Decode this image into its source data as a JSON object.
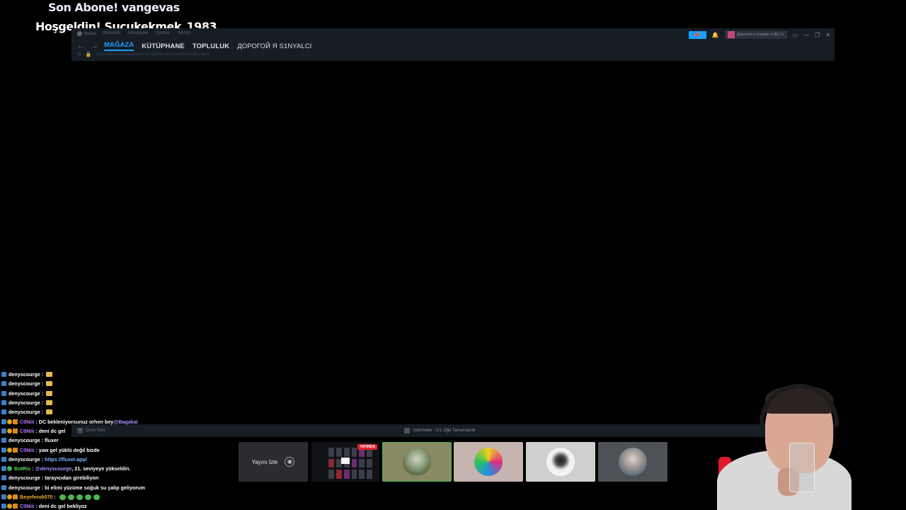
{
  "alerts": {
    "subscriber": "Son Abone! vangevas",
    "follower": "Hoşgeldin! Sucukekmek_1983"
  },
  "steam": {
    "menu": [
      "Steam",
      "Görünüm",
      "Arkadaşlar",
      "Oyunlar",
      "Yardım"
    ],
    "tabs": {
      "store": "MAĞAZA",
      "library": "KÜTÜPHANE",
      "community": "TOPLULUK",
      "profile": "ДОРОГОЙ Я S1NYALCI"
    },
    "url": "https://store.steampowered.com/point/cshop/cprofilebundle/odact/",
    "account": "Дорогой я s1nyalcı ▾ $0.71",
    "add_game": "Oyun Ekle",
    "downloads": "İndirmeler - 1/1 Öğe Tamamlandı",
    "colors": {
      "accent": "#1a9fff",
      "bg": "#171d25"
    }
  },
  "stream_tiles": {
    "watch_label": "Yayını İzle",
    "live_badge": "YAYINDA"
  },
  "chat": [
    {
      "user": "denyscourge",
      "text": "",
      "emote": true,
      "color": "#ffffff",
      "badges": [
        "pl"
      ]
    },
    {
      "user": "denyscourge",
      "text": "",
      "emote": true,
      "color": "#ffffff",
      "badges": [
        "pl"
      ]
    },
    {
      "user": "denyscourge",
      "text": "",
      "emote": true,
      "color": "#ffffff",
      "badges": [
        "pl"
      ]
    },
    {
      "user": "denyscourge",
      "text": "",
      "emote": true,
      "color": "#ffffff",
      "badges": [
        "pl"
      ]
    },
    {
      "user": "denyscourge",
      "text": "",
      "emote": true,
      "color": "#ffffff",
      "badges": [
        "pl"
      ]
    },
    {
      "user": "C0Niii",
      "text": "DC bekleniyorsunuz orhen bey ",
      "mention": "@Bagakai",
      "color": "#b57cff",
      "badges": [
        "pl",
        "mod",
        "sub"
      ]
    },
    {
      "user": "C0Niii",
      "text": "deni dc gel",
      "color": "#b57cff",
      "badges": [
        "pl",
        "mod",
        "sub"
      ]
    },
    {
      "user": "denyscourge",
      "text": "fluxer",
      "color": "#ffffff",
      "badges": [
        "pl"
      ]
    },
    {
      "user": "C0Niii",
      "text": "yaw gel yüklü değil bizde",
      "color": "#b57cff",
      "badges": [
        "pl",
        "mod",
        "sub"
      ]
    },
    {
      "user": "denyscourge",
      "text": "",
      "link": "https://fluxer.app/",
      "color": "#ffffff",
      "badges": [
        "pl"
      ]
    },
    {
      "user": "BotRix",
      "text": ", 21. seviyeye yükseldin.",
      "mention": "@denyscourge",
      "mention_first": true,
      "color": "#5fd35f",
      "badges": [
        "pl",
        "bot"
      ]
    },
    {
      "user": "denyscourge",
      "text": "tarayıcıdan girebiliyon",
      "color": "#ffffff",
      "badges": [
        "pl"
      ]
    },
    {
      "user": "denyscourge",
      "text": "bi elimi yüzüme soğuk su çalıp geliyorum",
      "color": "#ffffff",
      "badges": [
        "pl"
      ]
    },
    {
      "user": "Beyefendi070",
      "text": "",
      "greens": 5,
      "color": "#f0b030",
      "badges": [
        "pl",
        "mod",
        "sub"
      ]
    },
    {
      "user": "C0Niii",
      "text": "deni dc gel bekliyoz",
      "color": "#b57cff",
      "badges": [
        "pl",
        "mod",
        "sub"
      ]
    }
  ]
}
